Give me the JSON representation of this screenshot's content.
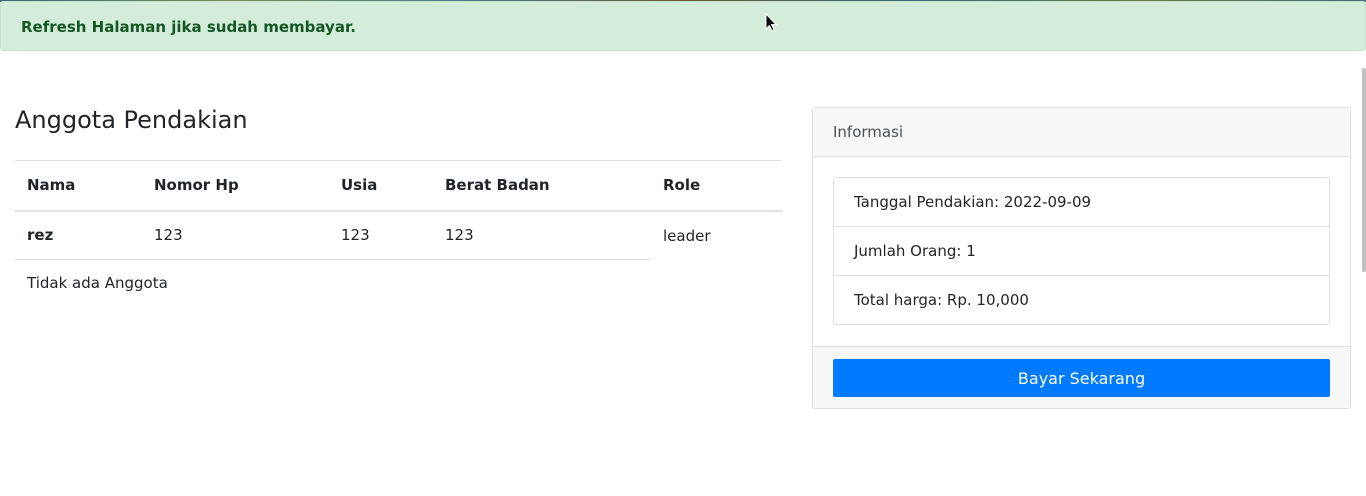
{
  "alert": {
    "message": "Refresh Halaman jika sudah membayar."
  },
  "members_section": {
    "title": "Anggota Pendakian",
    "columns": [
      "Nama",
      "Nomor Hp",
      "Usia",
      "Berat Badan",
      "Role"
    ],
    "rows": [
      {
        "nama": "rez",
        "nomor_hp": "123",
        "usia": "123",
        "berat_badan": "123",
        "role": "leader"
      }
    ],
    "empty_text": "Tidak ada Anggota"
  },
  "info_card": {
    "header": "Informasi",
    "items": [
      "Tanggal Pendakian: 2022-09-09",
      "Jumlah Orang: 1",
      "Total harga: Rp. 10,000"
    ],
    "pay_button_label": "Bayar Sekarang"
  },
  "colors": {
    "alert_bg": "#d4edda",
    "alert_text": "#155724",
    "primary": "#007bff"
  }
}
